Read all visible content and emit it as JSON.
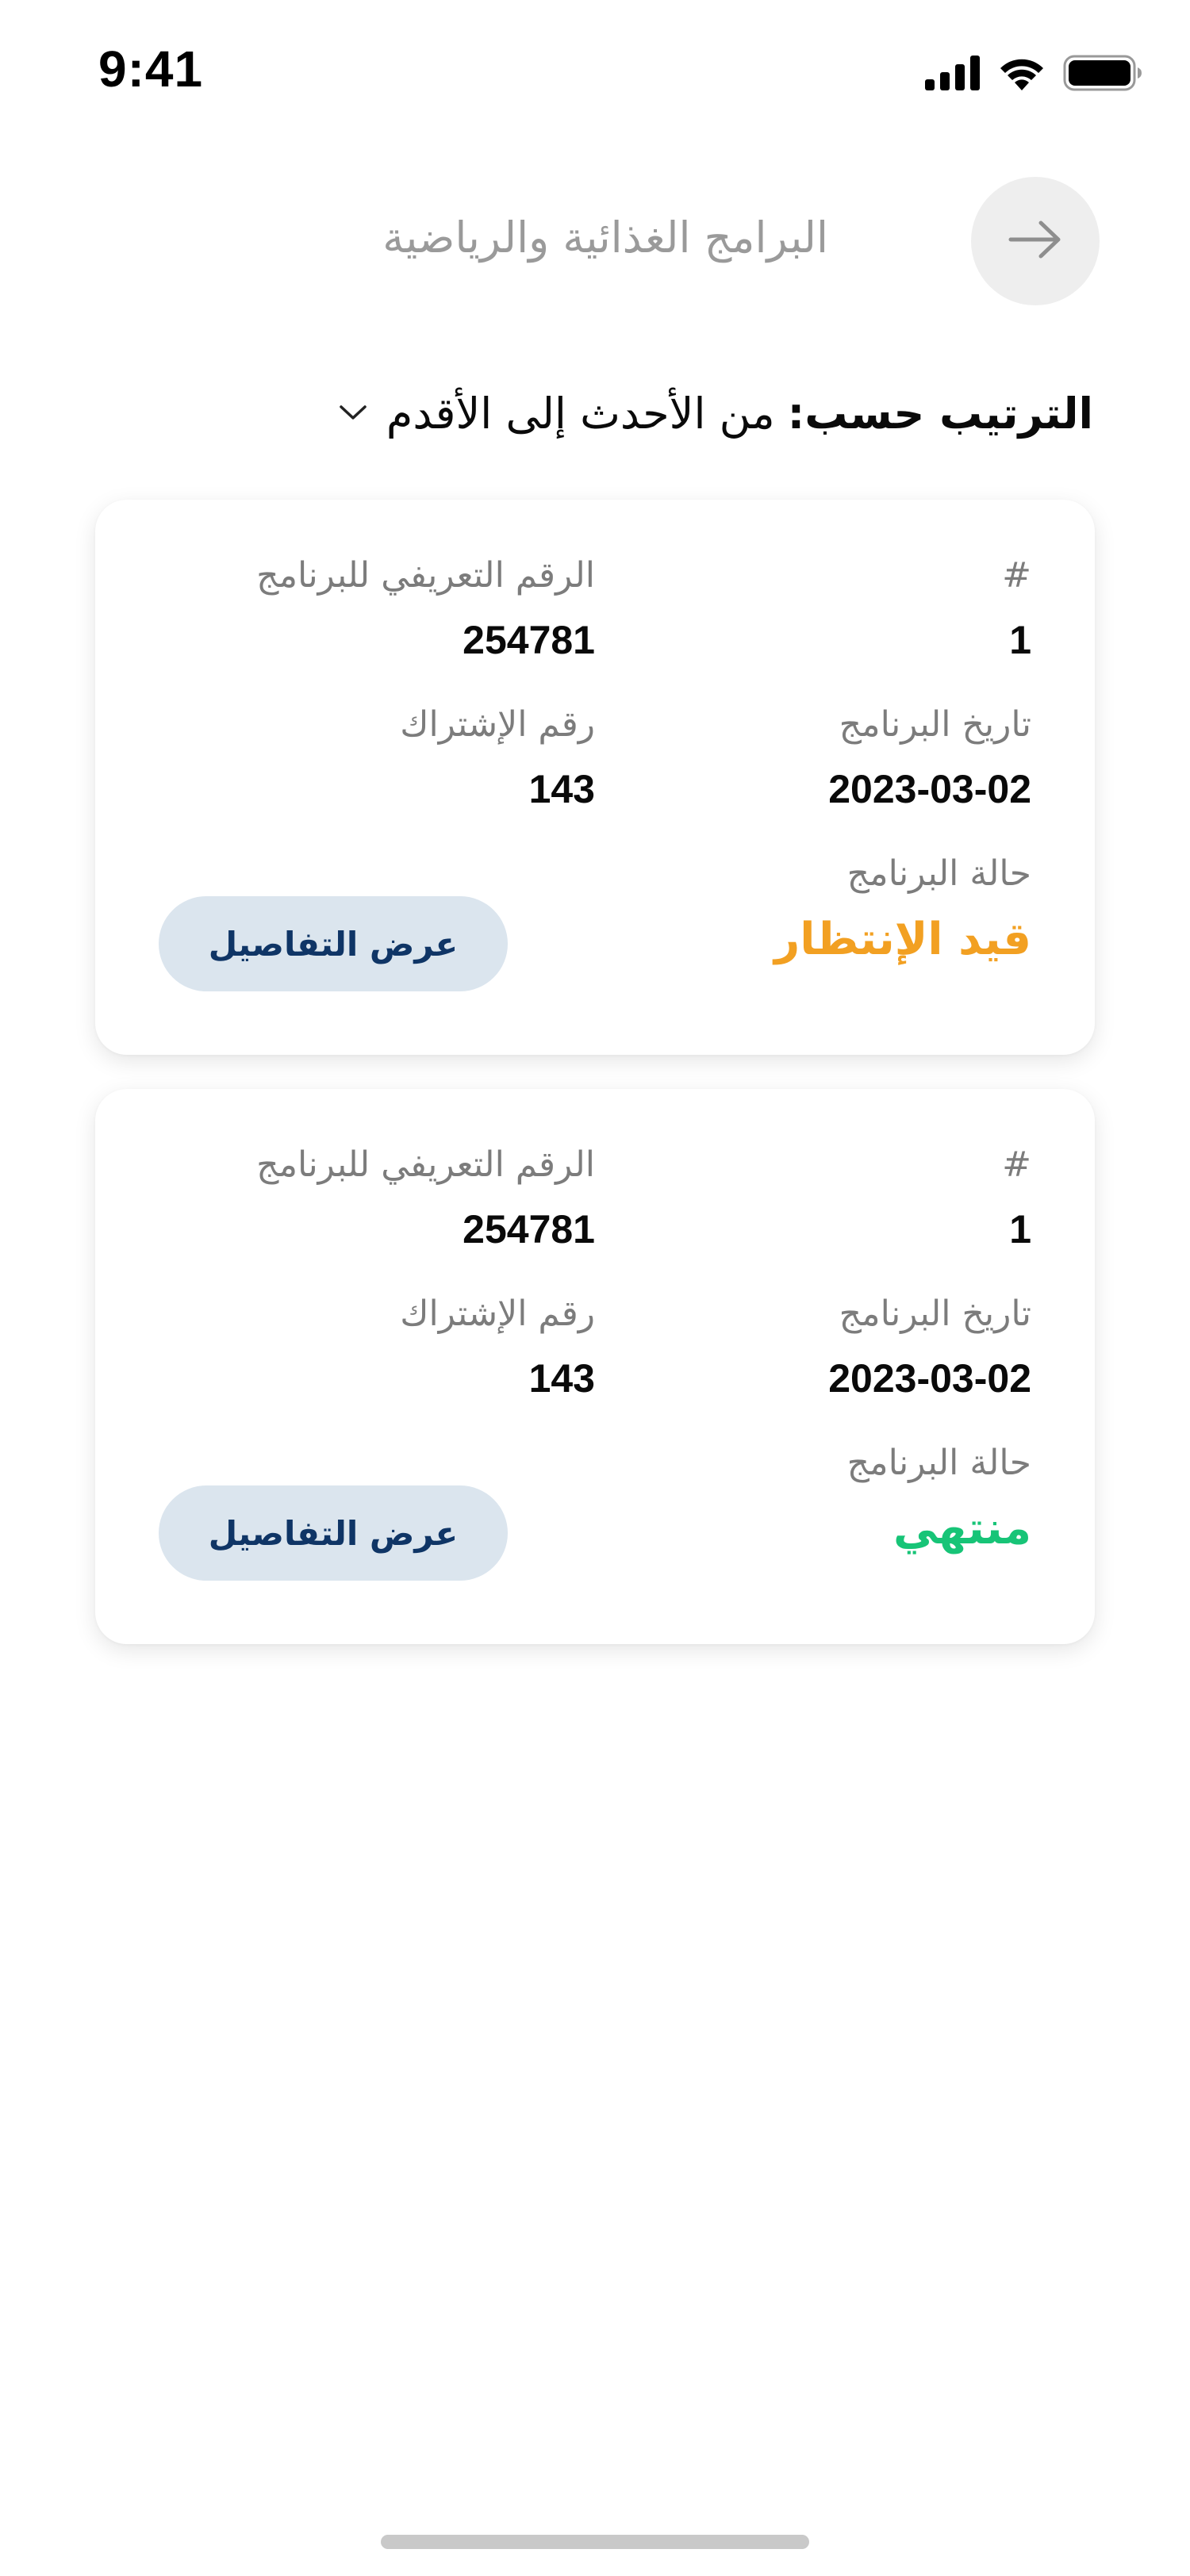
{
  "status_bar": {
    "time": "9:41",
    "icons": [
      "cellular-signal-icon",
      "wifi-icon",
      "battery-icon"
    ]
  },
  "header": {
    "title": "البرامج الغذائية والرياضية",
    "back_icon": "arrow-right-icon"
  },
  "sort": {
    "label": "الترتيب حسب:",
    "value": "من الأحدث إلى الأقدم",
    "icon": "chevron-down-icon"
  },
  "colors": {
    "pending": "#f2a022",
    "finished": "#17c477",
    "button_bg": "#dbe5ee",
    "button_text": "#0f3566"
  },
  "cards": [
    {
      "index_label": "#",
      "index_value": "1",
      "program_id_label": "الرقم التعريفي للبرنامج",
      "program_id_value": "254781",
      "date_label": "تاريخ البرنامج",
      "date_value": "2023-03-02",
      "subscription_label": "رقم الإشتراك",
      "subscription_value": "143",
      "status_label": "حالة البرنامج",
      "status_value": "قيد الإنتظار",
      "details_button": "عرض التفاصيل"
    },
    {
      "index_label": "#",
      "index_value": "1",
      "program_id_label": "الرقم التعريفي للبرنامج",
      "program_id_value": "254781",
      "date_label": "تاريخ البرنامج",
      "date_value": "2023-03-02",
      "subscription_label": "رقم الإشتراك",
      "subscription_value": "143",
      "status_label": "حالة البرنامج",
      "status_value": "منتهي",
      "details_button": "عرض التفاصيل"
    }
  ]
}
